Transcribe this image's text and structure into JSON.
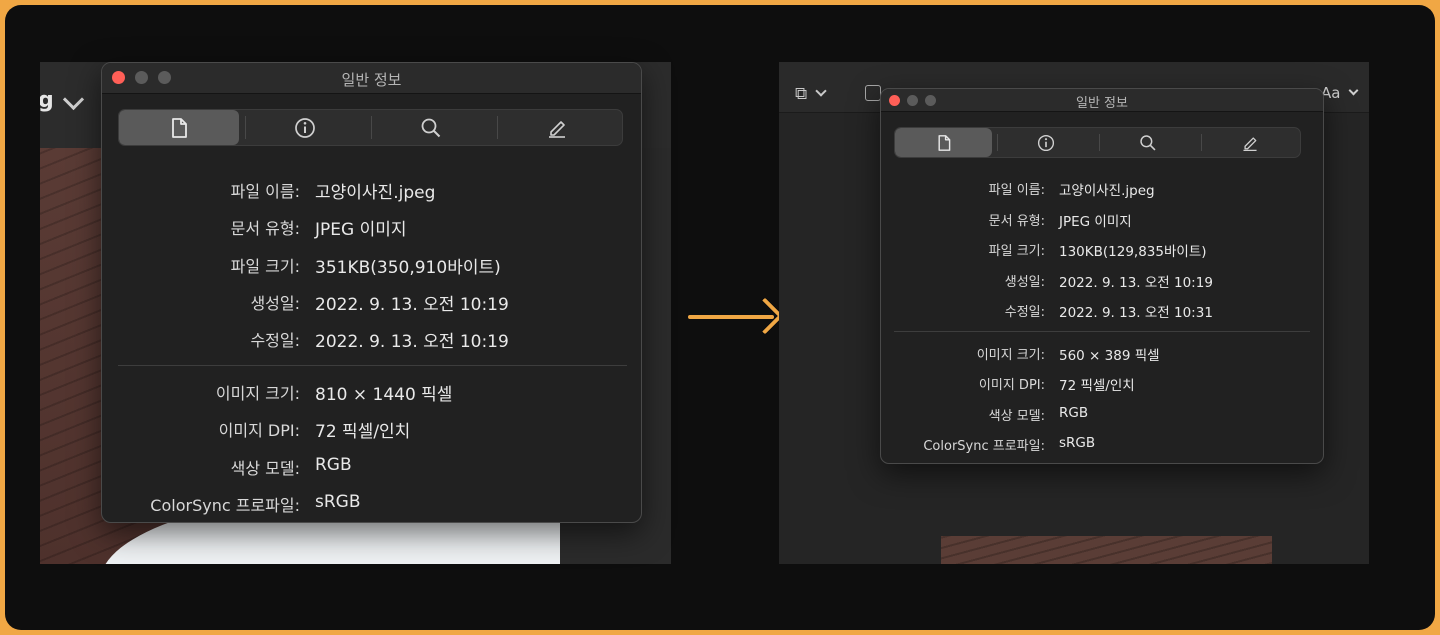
{
  "left_window": {
    "toolbar_partial_text": "g",
    "title": "일반 정보",
    "tabs": [
      "file-tab",
      "info-tab",
      "search-tab",
      "annotate-tab"
    ],
    "general": [
      {
        "label": "파일 이름:",
        "value": "고양이사진.jpeg"
      },
      {
        "label": "문서 유형:",
        "value": "JPEG 이미지"
      },
      {
        "label": "파일 크기:",
        "value": "351KB(350,910바이트)"
      },
      {
        "label": "생성일:",
        "value": "2022. 9. 13. 오전 10:19"
      },
      {
        "label": "수정일:",
        "value": "2022. 9. 13. 오전 10:19"
      }
    ],
    "image": [
      {
        "label": "이미지 크기:",
        "value": "810 × 1440 픽셀"
      },
      {
        "label": "이미지 DPI:",
        "value": "72 픽셀/인치"
      },
      {
        "label": "색상 모델:",
        "value": "RGB"
      },
      {
        "label": "ColorSync 프로파일:",
        "value": "sRGB"
      }
    ]
  },
  "right_window": {
    "toolbar_text": "Aa",
    "title": "일반 정보",
    "general": [
      {
        "label": "파일 이름:",
        "value": "고양이사진.jpeg"
      },
      {
        "label": "문서 유형:",
        "value": "JPEG 이미지"
      },
      {
        "label": "파일 크기:",
        "value": "130KB(129,835바이트)"
      },
      {
        "label": "생성일:",
        "value": "2022. 9. 13. 오전 10:19"
      },
      {
        "label": "수정일:",
        "value": "2022. 9. 13. 오전 10:31"
      }
    ],
    "image": [
      {
        "label": "이미지 크기:",
        "value": "560 × 389 픽셀"
      },
      {
        "label": "이미지 DPI:",
        "value": "72 픽셀/인치"
      },
      {
        "label": "색상 모델:",
        "value": "RGB"
      },
      {
        "label": "ColorSync 프로파일:",
        "value": "sRGB"
      }
    ]
  },
  "colors": {
    "accent_border": "#f0a744",
    "arrow": "#f0a744",
    "close_button": "#ff5f57"
  }
}
